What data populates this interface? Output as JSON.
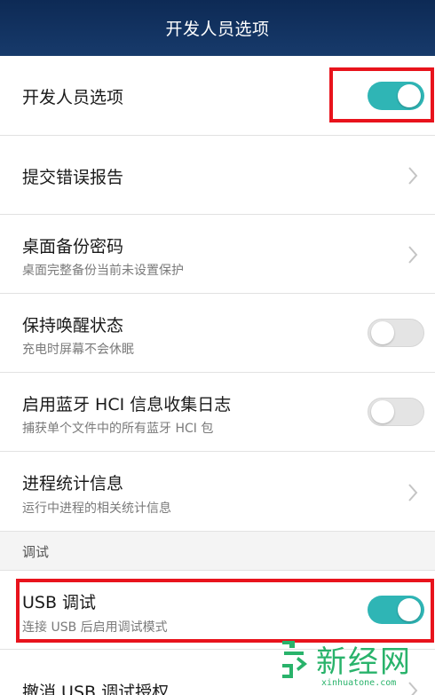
{
  "header": {
    "title": "开发人员选项"
  },
  "rows": [
    {
      "title": "开发人员选项"
    },
    {
      "title": "提交错误报告"
    },
    {
      "title": "桌面备份密码",
      "subtitle": "桌面完整备份当前未设置保护"
    },
    {
      "title": "保持唤醒状态",
      "subtitle": "充电时屏幕不会休眠"
    },
    {
      "title": "启用蓝牙 HCI 信息收集日志",
      "subtitle": "捕获单个文件中的所有蓝牙 HCI 包"
    },
    {
      "title": "进程统计信息",
      "subtitle": "运行中进程的相关统计信息"
    },
    {
      "title": "USB 调试",
      "subtitle": "连接 USB 后启用调试模式"
    },
    {
      "title": "撤消 USB 调试授权"
    }
  ],
  "toggles": {
    "developer_options": true,
    "stay_awake": false,
    "bluetooth_hci_log": false,
    "usb_debugging": true
  },
  "section_debug": {
    "label": "调试"
  },
  "watermark": {
    "brand": "新经网",
    "url": "xinhuatone.com"
  },
  "colors": {
    "titlebar": "#0d2a55",
    "toggle_on": "#2fb5b5",
    "toggle_off": "#e4e4e4",
    "highlight": "#e8131c",
    "watermark": "#29b36b"
  }
}
